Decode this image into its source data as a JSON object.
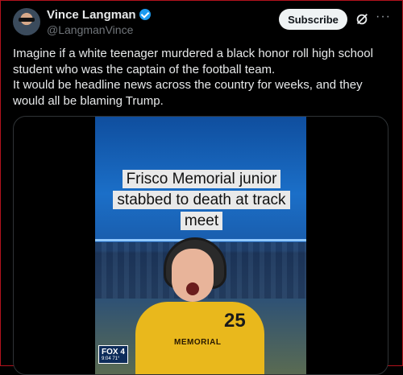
{
  "author": {
    "name": "Vince Langman",
    "handle": "@LangmanVince",
    "verified": true,
    "avatar_icon": "profile-avatar"
  },
  "actions": {
    "subscribe_label": "Subscribe",
    "grok_icon": "grok-icon",
    "more_icon": "more-options-icon"
  },
  "tweet": {
    "text": "Imagine if a white teenager murdered a black honor roll high school student who was the captain of the football team.\nIt would be headline news across the country for weeks, and they would all be blaming Trump."
  },
  "media": {
    "caption": "Frisco Memorial junior stabbed to death at track meet",
    "jersey_text": "MEMORIAL",
    "jersey_number": "25",
    "channel_logo": "FOX 4",
    "channel_time": "9:04 71°"
  },
  "colors": {
    "background": "#000000",
    "text": "#e7e9ea",
    "secondary_text": "#71767b",
    "verified": "#1d9bf0",
    "subscribe_bg": "#eff3f4"
  }
}
